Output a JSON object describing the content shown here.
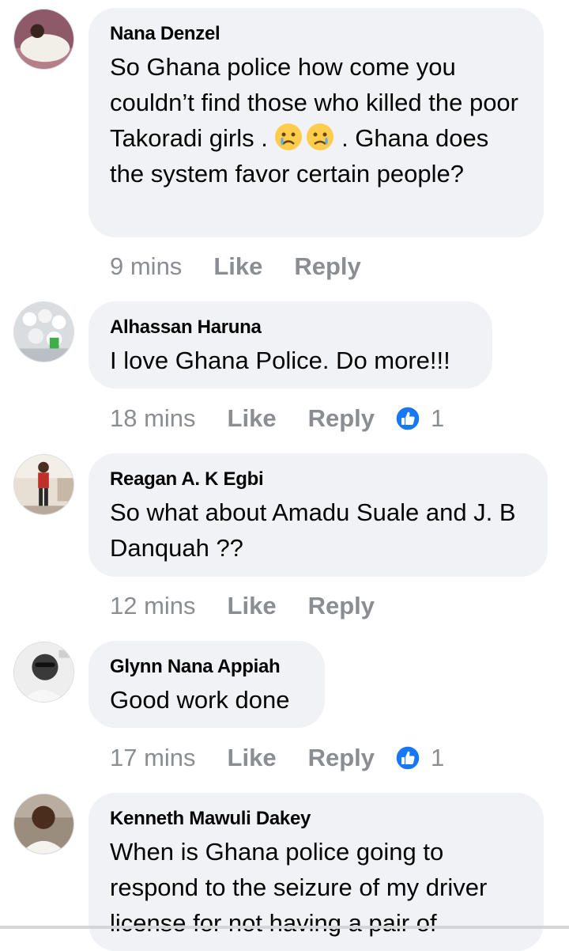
{
  "comments": [
    {
      "author": "Nana Denzel",
      "text_pre": "So Ghana police how come you couldn’t find those who killed the poor Takoradi girls . ",
      "text_post": " . Ghana does the system favor certain people?",
      "emoji_icons": [
        "crying-face",
        "sad-face"
      ],
      "time": "9 mins",
      "like_label": "Like",
      "reply_label": "Reply"
    },
    {
      "author": "Alhassan Haruna",
      "text": "I love Ghana Police. Do more!!!",
      "time": "18 mins",
      "like_label": "Like",
      "reply_label": "Reply",
      "reaction_icon": "thumbs-up-icon",
      "reaction_count": "1"
    },
    {
      "author": "Reagan A. K Egbi",
      "text": "So what about Amadu Suale and J. B Danquah ??",
      "time": "12 mins",
      "like_label": "Like",
      "reply_label": "Reply"
    },
    {
      "author": "Glynn Nana Appiah",
      "text": "Good work done",
      "time": "17 mins",
      "like_label": "Like",
      "reply_label": "Reply",
      "reaction_icon": "thumbs-up-icon",
      "reaction_count": "1"
    },
    {
      "author": "Kenneth Mawuli Dakey",
      "text": "When is Ghana police going to respond to the seizure of my driver license for not having a pair of"
    }
  ],
  "colors": {
    "bubble": "#f0f2f5",
    "meta_text": "#8a8d91",
    "like_blue": "#1877f2"
  }
}
